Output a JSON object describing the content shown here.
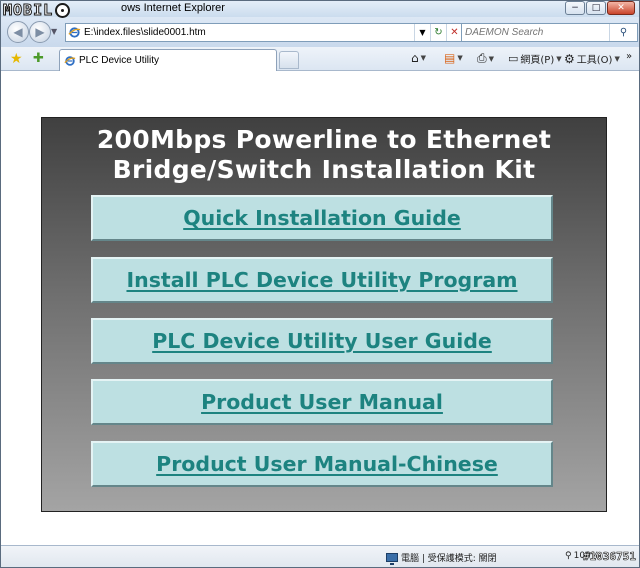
{
  "watermark": {
    "logo_text": "MOBILE",
    "photo_id": "#1036751"
  },
  "window": {
    "title": "ows Internet Explorer",
    "controls": {
      "minimize": "−",
      "maximize": "□",
      "close": "✕"
    }
  },
  "address_bar": {
    "url": "E:\\index.files\\slide0001.htm",
    "refresh_symbol": "↻",
    "stop_symbol": "✕"
  },
  "search": {
    "placeholder": "DAEMON Search",
    "go_symbol": "⚲"
  },
  "tabs": [
    {
      "label": "PLC Device Utility"
    }
  ],
  "command_bar": {
    "page_label": "網頁(P)",
    "tools_label": "工具(O)",
    "more_symbol": "»"
  },
  "slide": {
    "title_line1": "200Mbps Powerline to Ethernet",
    "title_line2": "Bridge/Switch Installation Kit",
    "links": [
      "Quick Installation Guide",
      "Install PLC Device Utility Program",
      "PLC Device Utility User Guide",
      "Product User Manual",
      "Product User Manual-Chinese"
    ]
  },
  "statusbar": {
    "zone_text": "電腦 | 受保護模式: 關閉",
    "zoom_text": "100%"
  },
  "colors": {
    "button_face": "#bde0e2",
    "link_text": "#1d8380",
    "slide_top": "#404040",
    "slide_bottom": "#a4a4a4"
  }
}
